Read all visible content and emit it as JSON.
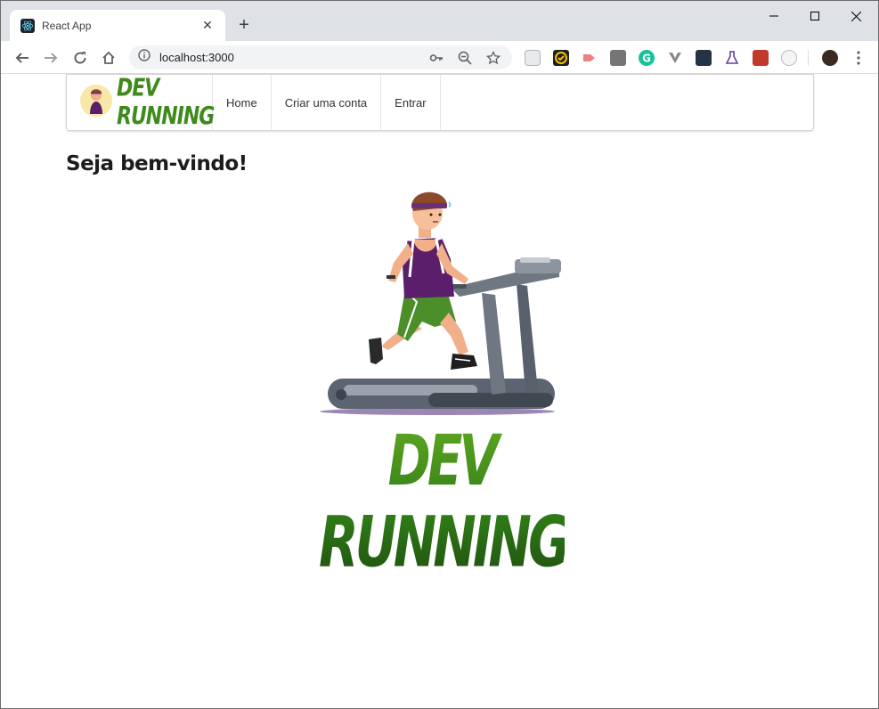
{
  "browser": {
    "tab_title": "React App",
    "tab_close": "✕",
    "new_tab": "+",
    "url": "localhost:3000",
    "window_minimize": "—",
    "window_maximize": "☐",
    "window_close": "✕"
  },
  "navbar": {
    "brand_text": "DEV RUNNING",
    "items": [
      "Home",
      "Criar uma conta",
      "Entrar"
    ]
  },
  "page": {
    "heading": "Seja bem-vindo!",
    "hero_text": "DEV RUNNING"
  },
  "colors": {
    "brand_green": "#3f8a1c",
    "shirt_purple": "#5a1e6b",
    "shorts_green": "#4c8f2a"
  }
}
